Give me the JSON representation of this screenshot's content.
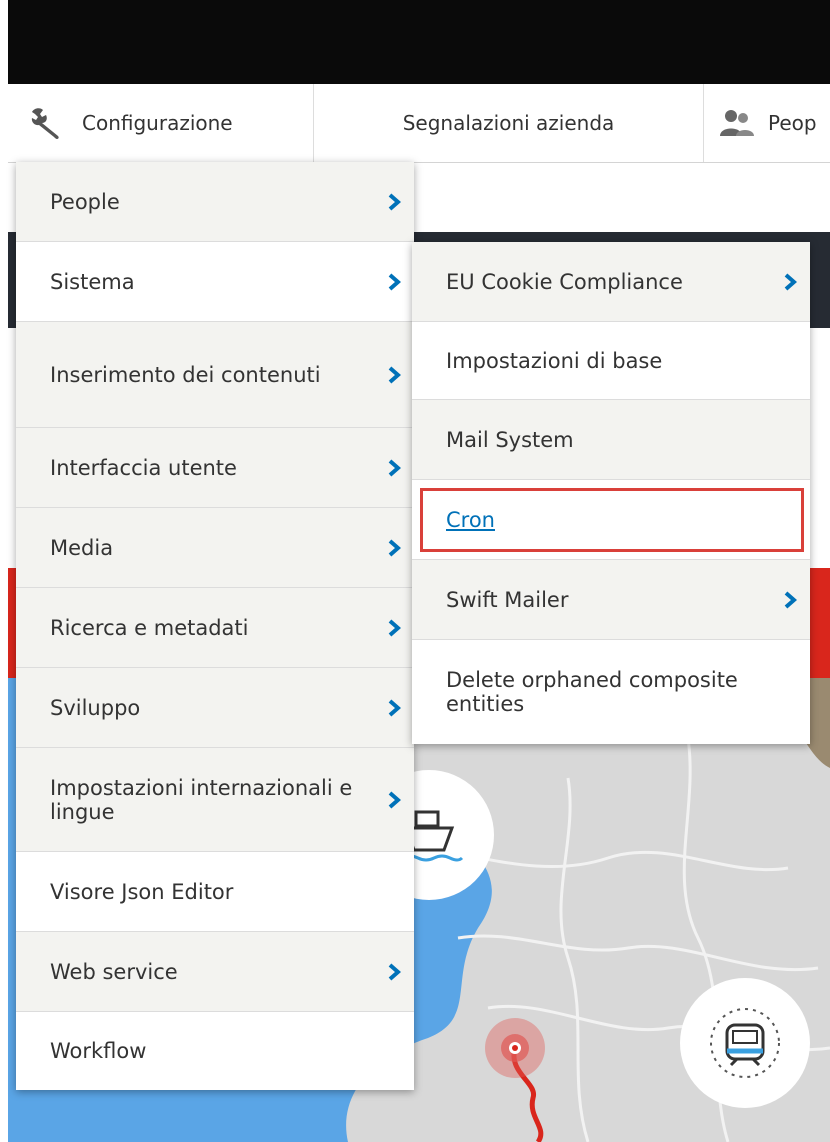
{
  "toolbar": {
    "configurazione_label": "Configurazione",
    "segnalazioni_label": "Segnalazioni azienda",
    "people_label": "Peop"
  },
  "main_menu": {
    "items": [
      {
        "label": "People",
        "has_children": true
      },
      {
        "label": "Sistema",
        "has_children": true,
        "active": true
      },
      {
        "label": "Inserimento dei contenuti",
        "has_children": true
      },
      {
        "label": "Interfaccia utente",
        "has_children": true
      },
      {
        "label": "Media",
        "has_children": true
      },
      {
        "label": "Ricerca e metadati",
        "has_children": true
      },
      {
        "label": "Sviluppo",
        "has_children": true
      },
      {
        "label": "Impostazioni internazionali e lingue",
        "has_children": true
      },
      {
        "label": "Visore Json Editor",
        "has_children": false,
        "active": true
      },
      {
        "label": "Web service",
        "has_children": true
      },
      {
        "label": "Workflow",
        "has_children": false,
        "active": true
      }
    ]
  },
  "sub_menu": {
    "items": [
      {
        "label": "EU Cookie Compliance",
        "has_children": true
      },
      {
        "label": "Impostazioni di base",
        "has_children": false,
        "active": true
      },
      {
        "label": "Mail System",
        "has_children": false
      },
      {
        "label": "Cron",
        "has_children": false,
        "active": true,
        "highlighted": true
      },
      {
        "label": "Swift Mailer",
        "has_children": true
      },
      {
        "label": "Delete orphaned composite entities",
        "has_children": false,
        "active": true
      }
    ]
  },
  "colors": {
    "chevron": "#0071b8",
    "link": "#0071b8",
    "highlight_border": "#d9403a",
    "dark_bar": "#0a0a0a",
    "red_band": "#d9261c",
    "sea": "#5aa5e6"
  }
}
